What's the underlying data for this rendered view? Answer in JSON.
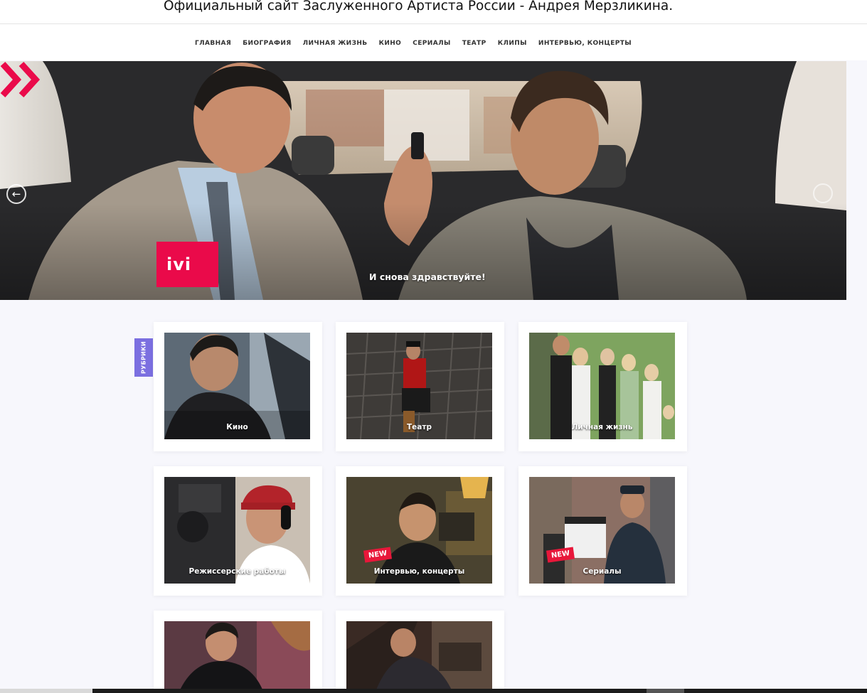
{
  "site": {
    "title": "Официальный сайт Заслуженного Артиста России - Андрея Мерзликина."
  },
  "nav": {
    "items": [
      "ГЛАВНАЯ",
      "БИОГРАФИЯ",
      "ЛИЧНАЯ ЖИЗНЬ",
      "КИНО",
      "СЕРИАЛЫ",
      "ТЕАТР",
      "КЛИПЫ",
      "ИНТЕРВЬЮ, КОНЦЕРТЫ"
    ]
  },
  "slider": {
    "caption": "И снова здравствуйте!",
    "logo_text": "ivi",
    "prev_icon": "arrow-left-icon",
    "next_icon": "arrow-right-icon",
    "prev_glyph": "←",
    "next_glyph": ""
  },
  "sidebar_tab": {
    "label": "РУБРИКИ"
  },
  "categories": [
    {
      "label": "Кино"
    },
    {
      "label": "Театр"
    },
    {
      "label": "Личная жизнь"
    },
    {
      "label": "Режиссерские работы"
    },
    {
      "label": "Интервью, концерты",
      "badge": "NEW"
    },
    {
      "label": "Сериалы",
      "badge": "NEW"
    },
    {
      "label": ""
    },
    {
      "label": ""
    }
  ],
  "colors": {
    "accent": "#7b6fe0",
    "ivi_brand": "#ea0a4a",
    "badge_new": "#e8173a"
  }
}
